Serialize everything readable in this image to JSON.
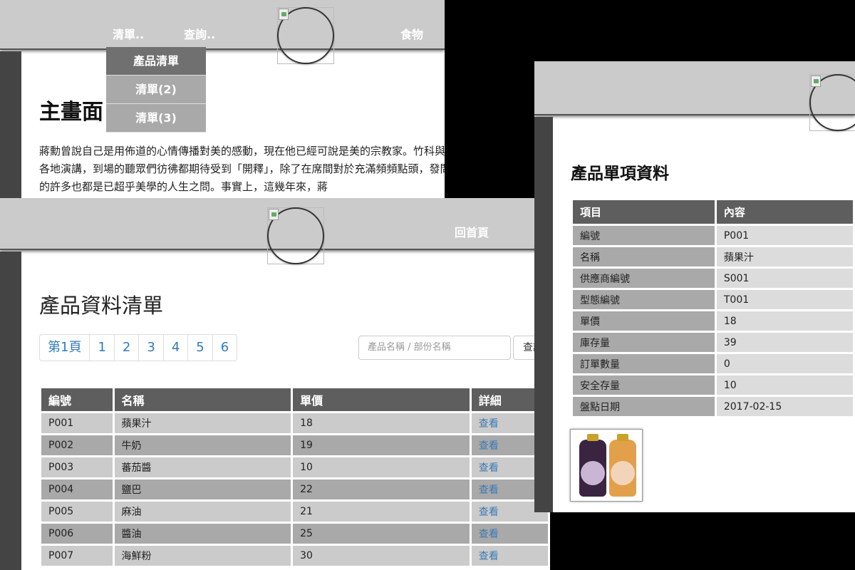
{
  "main_window": {
    "nav": {
      "list_menu": "清單..",
      "query_menu": "查詢..",
      "food_link": "食物"
    },
    "dropdown": {
      "items": [
        {
          "label": "產品清單",
          "active": true
        },
        {
          "label": "清單(2)",
          "active": false
        },
        {
          "label": "清單(3)",
          "active": false
        }
      ]
    },
    "title": "主畫面",
    "paragraph": "蔣勳曾說自己是用佈道的心情傳播對美的感動，現在他已經可說是美的宗教家。竹科與各地演講，到場的聽眾們彷彿都期待受到「開釋」，除了在席間對於充滿頻頻點頭，發問的許多也都是已超乎美學的人生之問。事實上，這幾年來，蔣"
  },
  "list_window": {
    "home_link": "回首頁",
    "title": "產品資料清單",
    "pager": [
      "第1頁",
      "1",
      "2",
      "3",
      "4",
      "5",
      "6"
    ],
    "search": {
      "placeholder": "產品名稱 / 部份名稱",
      "button": "查詢"
    },
    "table": {
      "headers": [
        "編號",
        "名稱",
        "單價",
        "詳細"
      ],
      "rows": [
        {
          "id": "P001",
          "name": "蘋果汁",
          "price": "18",
          "detail": "查看"
        },
        {
          "id": "P002",
          "name": "牛奶",
          "price": "19",
          "detail": "查看"
        },
        {
          "id": "P003",
          "name": "蕃茄醬",
          "price": "10",
          "detail": "查看"
        },
        {
          "id": "P004",
          "name": "鹽巴",
          "price": "22",
          "detail": "查看"
        },
        {
          "id": "P005",
          "name": "麻油",
          "price": "21",
          "detail": "查看"
        },
        {
          "id": "P006",
          "name": "醬油",
          "price": "25",
          "detail": "查看"
        },
        {
          "id": "P007",
          "name": "海鮮粉",
          "price": "30",
          "detail": "查看"
        }
      ]
    }
  },
  "detail_window": {
    "title": "產品單項資料",
    "table": {
      "headers": [
        "項目",
        "內容"
      ],
      "rows": [
        {
          "key": "編號",
          "value": "P001"
        },
        {
          "key": "名稱",
          "value": "蘋果汁"
        },
        {
          "key": "供應商編號",
          "value": "S001"
        },
        {
          "key": "型態編號",
          "value": "T001"
        },
        {
          "key": "單價",
          "value": "18"
        },
        {
          "key": "庫存量",
          "value": "39"
        },
        {
          "key": "訂單數量",
          "value": "0"
        },
        {
          "key": "安全存量",
          "value": "10"
        },
        {
          "key": "盤點日期",
          "value": "2017-02-15"
        }
      ]
    },
    "product_image": "juice-bottles-image"
  },
  "colors": {
    "header_bg": "#cbcbcb",
    "sidebar_bg": "#444444",
    "table_header_bg": "#5e5e5e",
    "row_light": "#cbcbcb",
    "row_dark": "#a9a9a9",
    "link": "#3a7ab6"
  }
}
